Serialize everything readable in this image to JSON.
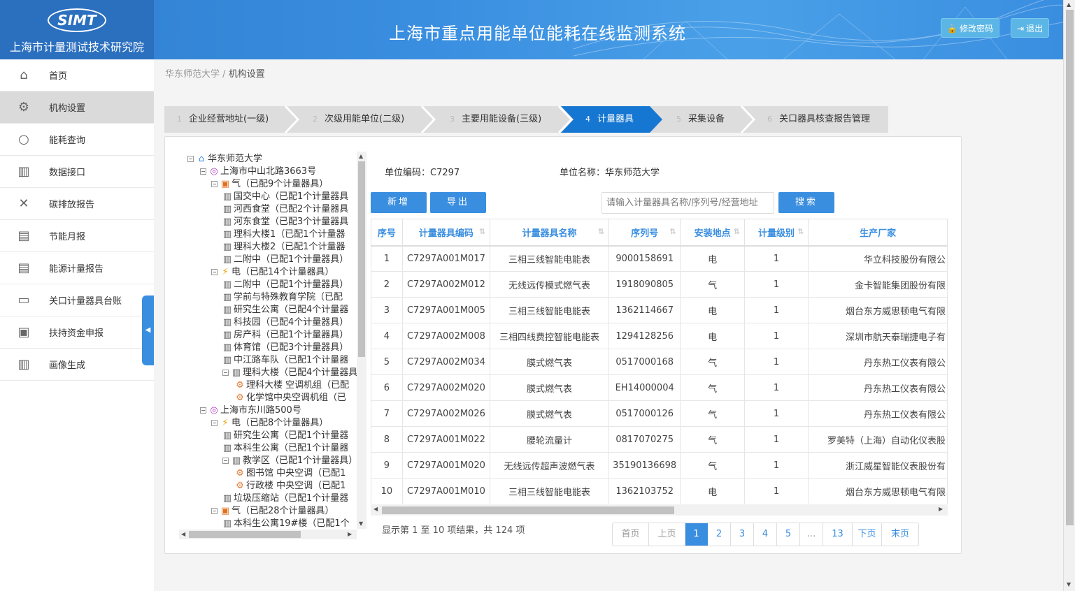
{
  "header": {
    "logo_badge": "SIMT",
    "org_name": "上海市计量测试技术研究院",
    "system_title": "上海市重点用能单位能耗在线监测系统",
    "change_password": "修改密码",
    "logout": "退出"
  },
  "sidebar": {
    "items": [
      {
        "label": "首页",
        "icon": "home-icon"
      },
      {
        "label": "机构设置",
        "icon": "gear-icon"
      },
      {
        "label": "能耗查询",
        "icon": "search-icon"
      },
      {
        "label": "数据接口",
        "icon": "chart-icon"
      },
      {
        "label": "碳排放报告",
        "icon": "tools-icon"
      },
      {
        "label": "节能月报",
        "icon": "report-icon"
      },
      {
        "label": "能源计量报告",
        "icon": "document-icon"
      },
      {
        "label": "关口计量器具台账",
        "icon": "ledger-icon"
      },
      {
        "label": "扶持资金申报",
        "icon": "monitor-icon"
      },
      {
        "label": "画像生成",
        "icon": "chart-icon"
      }
    ]
  },
  "breadcrumb": {
    "parent": "华东师范大学",
    "sep": "/",
    "current": "机构设置"
  },
  "steps": [
    {
      "num": "1",
      "label": "企业经营地址(一级)"
    },
    {
      "num": "2",
      "label": "次级用能单位(二级)"
    },
    {
      "num": "3",
      "label": "主要用能设备(三级)"
    },
    {
      "num": "4",
      "label": "计量器具"
    },
    {
      "num": "5",
      "label": "采集设备"
    },
    {
      "num": "6",
      "label": "关口器具核查报告管理"
    }
  ],
  "tree": [
    {
      "text": "华东师范大学",
      "toggle": "⊟",
      "icon": "home"
    },
    {
      "text": "上海市中山北路3663号",
      "toggle": "⊟",
      "icon": "pin"
    },
    {
      "text": "气（已配9个计量器具）",
      "toggle": "⊟",
      "icon": "gas"
    },
    {
      "text": "国交中心（已配1个计量器具",
      "toggle": "",
      "icon": "bldg"
    },
    {
      "text": "河西食堂（已配2个计量器具",
      "toggle": "",
      "icon": "bldg"
    },
    {
      "text": "河东食堂（已配3个计量器具",
      "toggle": "",
      "icon": "bldg"
    },
    {
      "text": "理科大楼1（已配1个计量器",
      "toggle": "",
      "icon": "bldg"
    },
    {
      "text": "理科大楼2（已配1个计量器",
      "toggle": "",
      "icon": "bldg"
    },
    {
      "text": "二附中（已配1个计量器具）",
      "toggle": "",
      "icon": "bldg"
    },
    {
      "text": "电（已配14个计量器具）",
      "toggle": "⊟",
      "icon": "elec"
    },
    {
      "text": "二附中（已配1个计量器具）",
      "toggle": "",
      "icon": "bldg"
    },
    {
      "text": "学前与特殊教育学院（已配",
      "toggle": "",
      "icon": "bldg"
    },
    {
      "text": "研究生公寓（已配4个计量器",
      "toggle": "",
      "icon": "bldg"
    },
    {
      "text": "科技园（已配4个计量器具）",
      "toggle": "",
      "icon": "bldg"
    },
    {
      "text": "房产科（已配1个计量器具）",
      "toggle": "",
      "icon": "bldg"
    },
    {
      "text": "体育馆（已配3个计量器具）",
      "toggle": "",
      "icon": "bldg"
    },
    {
      "text": "中江路车队（已配1个计量器",
      "toggle": "",
      "icon": "bldg"
    },
    {
      "text": "理科大楼（已配4个计量器具",
      "toggle": "⊟",
      "icon": "bldg"
    },
    {
      "text": "理科大楼 空调机组（已配",
      "toggle": "",
      "icon": "cog"
    },
    {
      "text": "化学馆中央空调机组（已",
      "toggle": "",
      "icon": "cog"
    },
    {
      "text": "上海市东川路500号",
      "toggle": "⊟",
      "icon": "pin"
    },
    {
      "text": "电（已配8个计量器具）",
      "toggle": "⊟",
      "icon": "elec"
    },
    {
      "text": "研究生公寓（已配1个计量器",
      "toggle": "",
      "icon": "bldg"
    },
    {
      "text": "本科生公寓（已配1个计量器",
      "toggle": "",
      "icon": "bldg"
    },
    {
      "text": "教学区（已配1个计量器具）",
      "toggle": "⊟",
      "icon": "bldg"
    },
    {
      "text": "图书馆 中央空调（已配1",
      "toggle": "",
      "icon": "cog"
    },
    {
      "text": "行政楼 中央空调（已配1",
      "toggle": "",
      "icon": "cog"
    },
    {
      "text": "垃圾压缩站（已配1个计量器",
      "toggle": "",
      "icon": "bldg"
    },
    {
      "text": "气（已配28个计量器具）",
      "toggle": "⊟",
      "icon": "gas"
    },
    {
      "text": "本科生公寓19#楼（已配1个",
      "toggle": "",
      "icon": "bldg"
    }
  ],
  "unit_info": {
    "code_label": "单位编码：",
    "code": "C7297",
    "name_label": "单位名称：",
    "name": "华东师范大学"
  },
  "actions": {
    "add": "新增",
    "export": "导出",
    "search": "搜索"
  },
  "search": {
    "placeholder": "请输入计量器具名称/序列号/经营地址"
  },
  "table": {
    "headers": [
      "序号",
      "计量器具编码",
      "计量器具名称",
      "序列号",
      "安装地点",
      "计量级别",
      "生产厂家"
    ],
    "rows": [
      [
        "1",
        "C7297A001M017",
        "三相三线智能电能表",
        "9000158691",
        "电",
        "1",
        "华立科技股份有限公"
      ],
      [
        "2",
        "C7297A002M012",
        "无线远传模式燃气表",
        "1918090805",
        "气",
        "1",
        "金卡智能集团股份有限"
      ],
      [
        "3",
        "C7297A001M005",
        "三相三线智能电能表",
        "1362114667",
        "电",
        "1",
        "烟台东方威思顿电气有限"
      ],
      [
        "4",
        "C7297A002M008",
        "三相四线费控智能电能表",
        "1294128256",
        "电",
        "1",
        "深圳市航天泰瑞捷电子有"
      ],
      [
        "5",
        "C7297A002M034",
        "膜式燃气表",
        "0517000168",
        "气",
        "1",
        "丹东热工仪表有限公"
      ],
      [
        "6",
        "C7297A002M020",
        "膜式燃气表",
        "EH14000004",
        "气",
        "1",
        "丹东热工仪表有限公"
      ],
      [
        "7",
        "C7297A002M026",
        "膜式燃气表",
        "0517000126",
        "气",
        "1",
        "丹东热工仪表有限公"
      ],
      [
        "8",
        "C7297A001M022",
        "腰轮流量计",
        "0817070275",
        "气",
        "1",
        "罗美特（上海）自动化仪表股"
      ],
      [
        "9",
        "C7297A001M020",
        "无线远传超声波燃气表",
        "35190136698",
        "气",
        "1",
        "浙江威星智能仪表股份有"
      ],
      [
        "10",
        "C7297A001M010",
        "三相三线智能电能表",
        "1362103752",
        "电",
        "1",
        "烟台东方威思顿电气有限"
      ]
    ]
  },
  "summary": "显示第 1 至 10 项结果，共 124 项",
  "pager": [
    "首页",
    "上页",
    "1",
    "2",
    "3",
    "4",
    "5",
    "…",
    "13",
    "下页",
    "末页"
  ]
}
